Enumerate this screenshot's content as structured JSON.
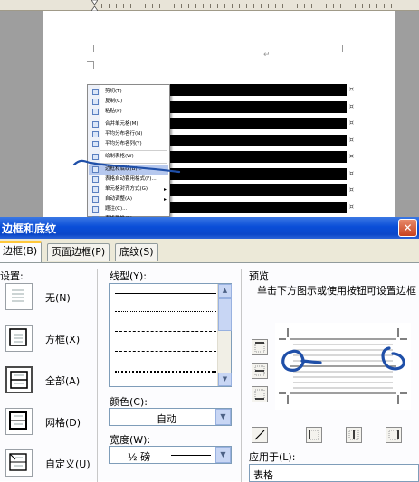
{
  "context_menu": {
    "items": [
      {
        "label": "剪切(T)",
        "icon": "cut-icon"
      },
      {
        "label": "复制(C)",
        "icon": "copy-icon"
      },
      {
        "label": "粘贴(P)",
        "icon": "paste-icon"
      },
      {
        "label": "合并单元格(M)",
        "icon": "merge-cells-icon"
      },
      {
        "label": "平均分布各行(N)",
        "icon": "distribute-rows-icon"
      },
      {
        "label": "平均分布各列(Y)",
        "icon": "distribute-columns-icon"
      },
      {
        "label": "绘制表格(W)",
        "icon": "draw-table-icon"
      },
      {
        "label": "边框和底纹(B)...",
        "icon": "borders-icon"
      },
      {
        "label": "表格自动套用格式(F)...",
        "icon": "autoformat-icon"
      },
      {
        "label": "单元格对齐方式(G)",
        "icon": "cell-align-icon"
      },
      {
        "label": "自动调整(A)",
        "icon": "autofit-icon"
      },
      {
        "label": "题注(C)...",
        "icon": "caption-icon"
      },
      {
        "label": "表格属性(R)...",
        "icon": "table-properties-icon"
      }
    ]
  },
  "dialog": {
    "title": "边框和底纹",
    "close_glyph": "✕",
    "tabs": [
      "边框(B)",
      "页面边框(P)",
      "底纹(S)"
    ],
    "active_tab": 0,
    "settings": {
      "label": "设置:",
      "options": [
        {
          "label": "无(N)",
          "icon": "border-none-icon"
        },
        {
          "label": "方框(X)",
          "icon": "border-box-icon"
        },
        {
          "label": "全部(A)",
          "icon": "border-all-icon"
        },
        {
          "label": "网格(D)",
          "icon": "border-grid-icon"
        },
        {
          "label": "自定义(U)",
          "icon": "border-custom-icon"
        }
      ],
      "selected": 2
    },
    "line_style": {
      "label": "线型(Y):"
    },
    "color": {
      "label": "颜色(C):",
      "value": "自动"
    },
    "width": {
      "label": "宽度(W):",
      "value": "½ 磅"
    },
    "preview": {
      "label": "预览",
      "hint": "单击下方图示或使用按钮可设置边框"
    },
    "apply_to": {
      "label": "应用于(L):",
      "value": "表格"
    }
  },
  "colors": {
    "title_bar": "#0a4ed8",
    "active_tab_accent": "#ffc83c",
    "scribble": "#1f4fa8",
    "menu_highlight": "#b6c8ee"
  }
}
